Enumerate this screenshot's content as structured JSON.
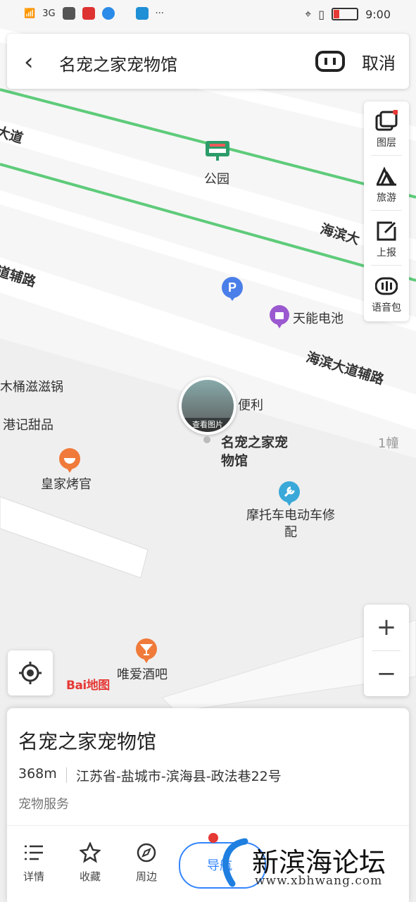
{
  "status_bar": {
    "network": "3G",
    "time": "9:00",
    "overflow": "···"
  },
  "search": {
    "title": "名宠之家宠物馆",
    "cancel_label": "取消"
  },
  "tools": [
    {
      "label": "图层",
      "icon": "layers-icon"
    },
    {
      "label": "旅游",
      "icon": "tourism-icon"
    },
    {
      "label": "上报",
      "icon": "report-icon"
    },
    {
      "label": "语音包",
      "icon": "voice-pack-icon"
    }
  ],
  "map": {
    "roads": [
      "大道",
      "海滨大",
      "道辅路",
      "海滨大道辅路"
    ],
    "park": "公园",
    "pois": {
      "battery": "天能电池",
      "hotpot": "木桶滋滋锅",
      "dessert": "港记甜品",
      "bbq": "皇家烤官",
      "convenience": "便利",
      "moto": "摩托车电动车修配",
      "bar": "唯爱酒吧",
      "building": "1幢",
      "selected": "名宠之家宠物馆",
      "photo_label": "查看图片"
    },
    "logo": "Bai地图"
  },
  "zoom": {
    "in": "+",
    "out": "−"
  },
  "card": {
    "name": "名宠之家宠物馆",
    "distance": "368m",
    "address": "江苏省-盐城市-滨海县-政法巷22号",
    "category": "宠物服务",
    "actions": [
      {
        "label": "详情",
        "icon": "list-icon"
      },
      {
        "label": "收藏",
        "icon": "star-icon"
      },
      {
        "label": "周边",
        "icon": "compass-icon"
      }
    ],
    "nav_label": "导航"
  },
  "watermark": {
    "title": "新滨海论坛",
    "url": "www.xbhwang.com"
  },
  "colors": {
    "road_green": "#5ecb7a",
    "accent_blue": "#3385ff",
    "parking_blue": "#4a7ee8",
    "poi_purple": "#9b59d0",
    "poi_orange": "#f07a3a",
    "poi_teal": "#3aa8d8"
  }
}
